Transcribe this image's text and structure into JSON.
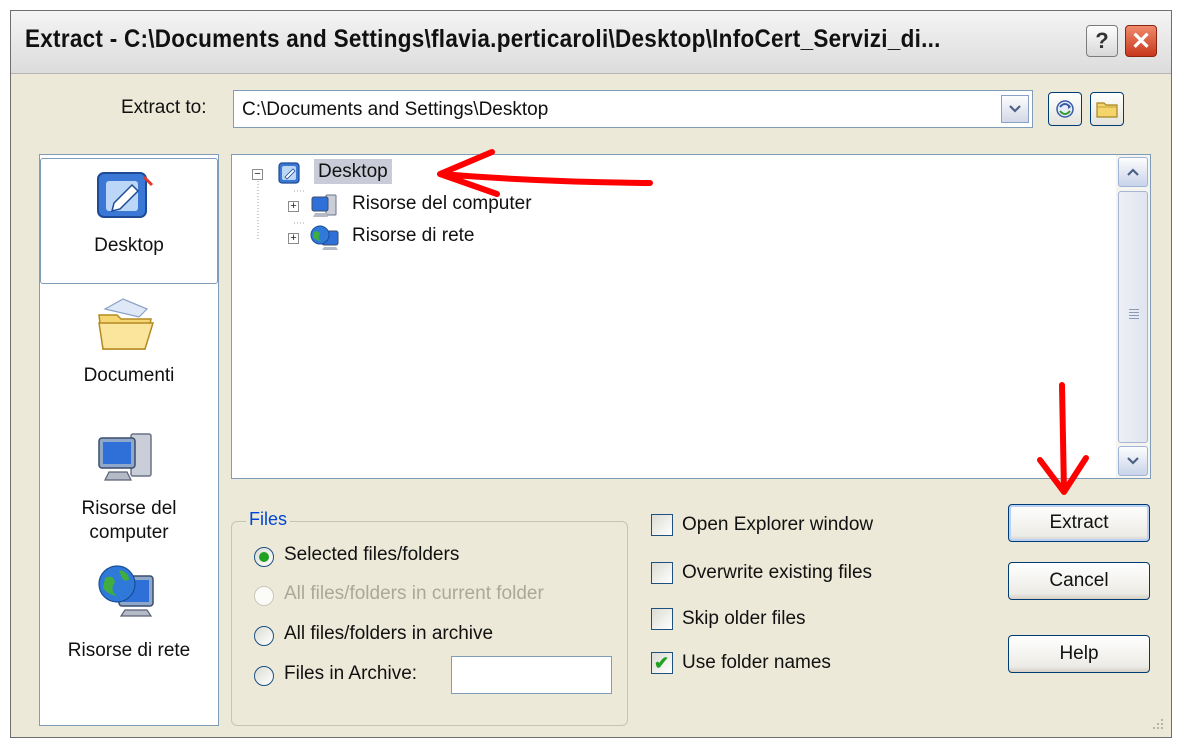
{
  "window": {
    "title": "Extract - C:\\Documents and Settings\\flavia.perticaroli\\Desktop\\InfoCert_Servizi_di...",
    "help_glyph": "?",
    "close_glyph": "✕"
  },
  "extract_to": {
    "label": "Extract to:",
    "value": "C:\\Documents and Settings\\Desktop"
  },
  "places": [
    {
      "label": "Desktop",
      "icon": "desktop-icon",
      "selected": true
    },
    {
      "label": "Documenti",
      "icon": "documents-folder-icon",
      "selected": false
    },
    {
      "label": "Risorse del computer",
      "icon": "my-computer-icon",
      "selected": false
    },
    {
      "label": "Risorse di rete",
      "icon": "network-places-icon",
      "selected": false
    }
  ],
  "tree": {
    "root": {
      "label": "Desktop",
      "icon": "desktop-icon",
      "expanded": true,
      "selected": true
    },
    "children": [
      {
        "label": "Risorse del computer",
        "icon": "my-computer-icon",
        "expanded": false
      },
      {
        "label": "Risorse di rete",
        "icon": "network-places-icon",
        "expanded": false
      }
    ]
  },
  "files_group": {
    "legend": "Files",
    "options": [
      {
        "label": "Selected files/folders",
        "checked": true,
        "enabled": true
      },
      {
        "label": "All files/folders in current folder",
        "checked": false,
        "enabled": false
      },
      {
        "label": "All files/folders in archive",
        "checked": false,
        "enabled": true
      },
      {
        "label": "Files in Archive:",
        "checked": false,
        "enabled": true
      }
    ],
    "files_in_archive_value": ""
  },
  "checkboxes": [
    {
      "label": "Open Explorer window",
      "checked": false
    },
    {
      "label": "Overwrite existing files",
      "checked": false
    },
    {
      "label": "Skip older files",
      "checked": false
    },
    {
      "label": "Use folder names",
      "checked": true
    }
  ],
  "buttons": {
    "extract": "Extract",
    "cancel": "Cancel",
    "help": "Help"
  },
  "colors": {
    "dialog_bg": "#ece9d8",
    "accent_blue": "#0046d5",
    "annotation_red": "#ff0000",
    "check_green": "#21a121"
  }
}
